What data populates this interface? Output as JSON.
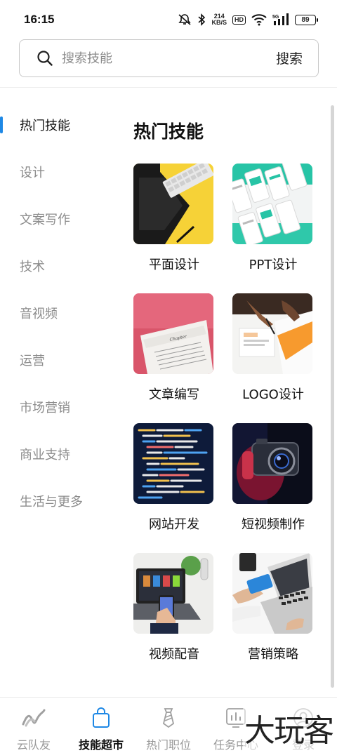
{
  "status_bar": {
    "time": "16:15",
    "speed_value": "214",
    "speed_unit": "KB/S",
    "hd": "HD",
    "signal_label": "5G",
    "battery": "89",
    "icons": [
      "mute-icon",
      "bluetooth-icon",
      "wifi-icon",
      "signal-icon",
      "battery-icon"
    ]
  },
  "search": {
    "placeholder": "搜索技能",
    "button": "搜索"
  },
  "sidebar": {
    "items": [
      {
        "label": "热门技能",
        "active": true
      },
      {
        "label": "设计"
      },
      {
        "label": "文案写作"
      },
      {
        "label": "技术"
      },
      {
        "label": "音视频"
      },
      {
        "label": "运营"
      },
      {
        "label": "市场营销"
      },
      {
        "label": "商业支持"
      },
      {
        "label": "生活与更多"
      }
    ]
  },
  "main": {
    "title": "热门技能",
    "tiles": [
      {
        "label": "平面设计"
      },
      {
        "label": "PPT设计"
      },
      {
        "label": "文章编写"
      },
      {
        "label": "LOGO设计"
      },
      {
        "label": "网站开发"
      },
      {
        "label": "短视频制作"
      },
      {
        "label": "视频配音"
      },
      {
        "label": "营销策略"
      }
    ]
  },
  "bottom_nav": {
    "items": [
      {
        "label": "云队友",
        "icon": "cloud-teammate-icon"
      },
      {
        "label": "技能超市",
        "icon": "shopping-bag-icon",
        "active": true
      },
      {
        "label": "热门职位",
        "icon": "tie-icon"
      },
      {
        "label": "任务中心",
        "icon": "task-chart-icon"
      },
      {
        "label": "登录",
        "icon": "user-icon"
      }
    ]
  },
  "watermark": "大玩客",
  "colors": {
    "accent": "#1e88e5",
    "text_primary": "#111111",
    "text_muted": "#8c8c8c"
  }
}
